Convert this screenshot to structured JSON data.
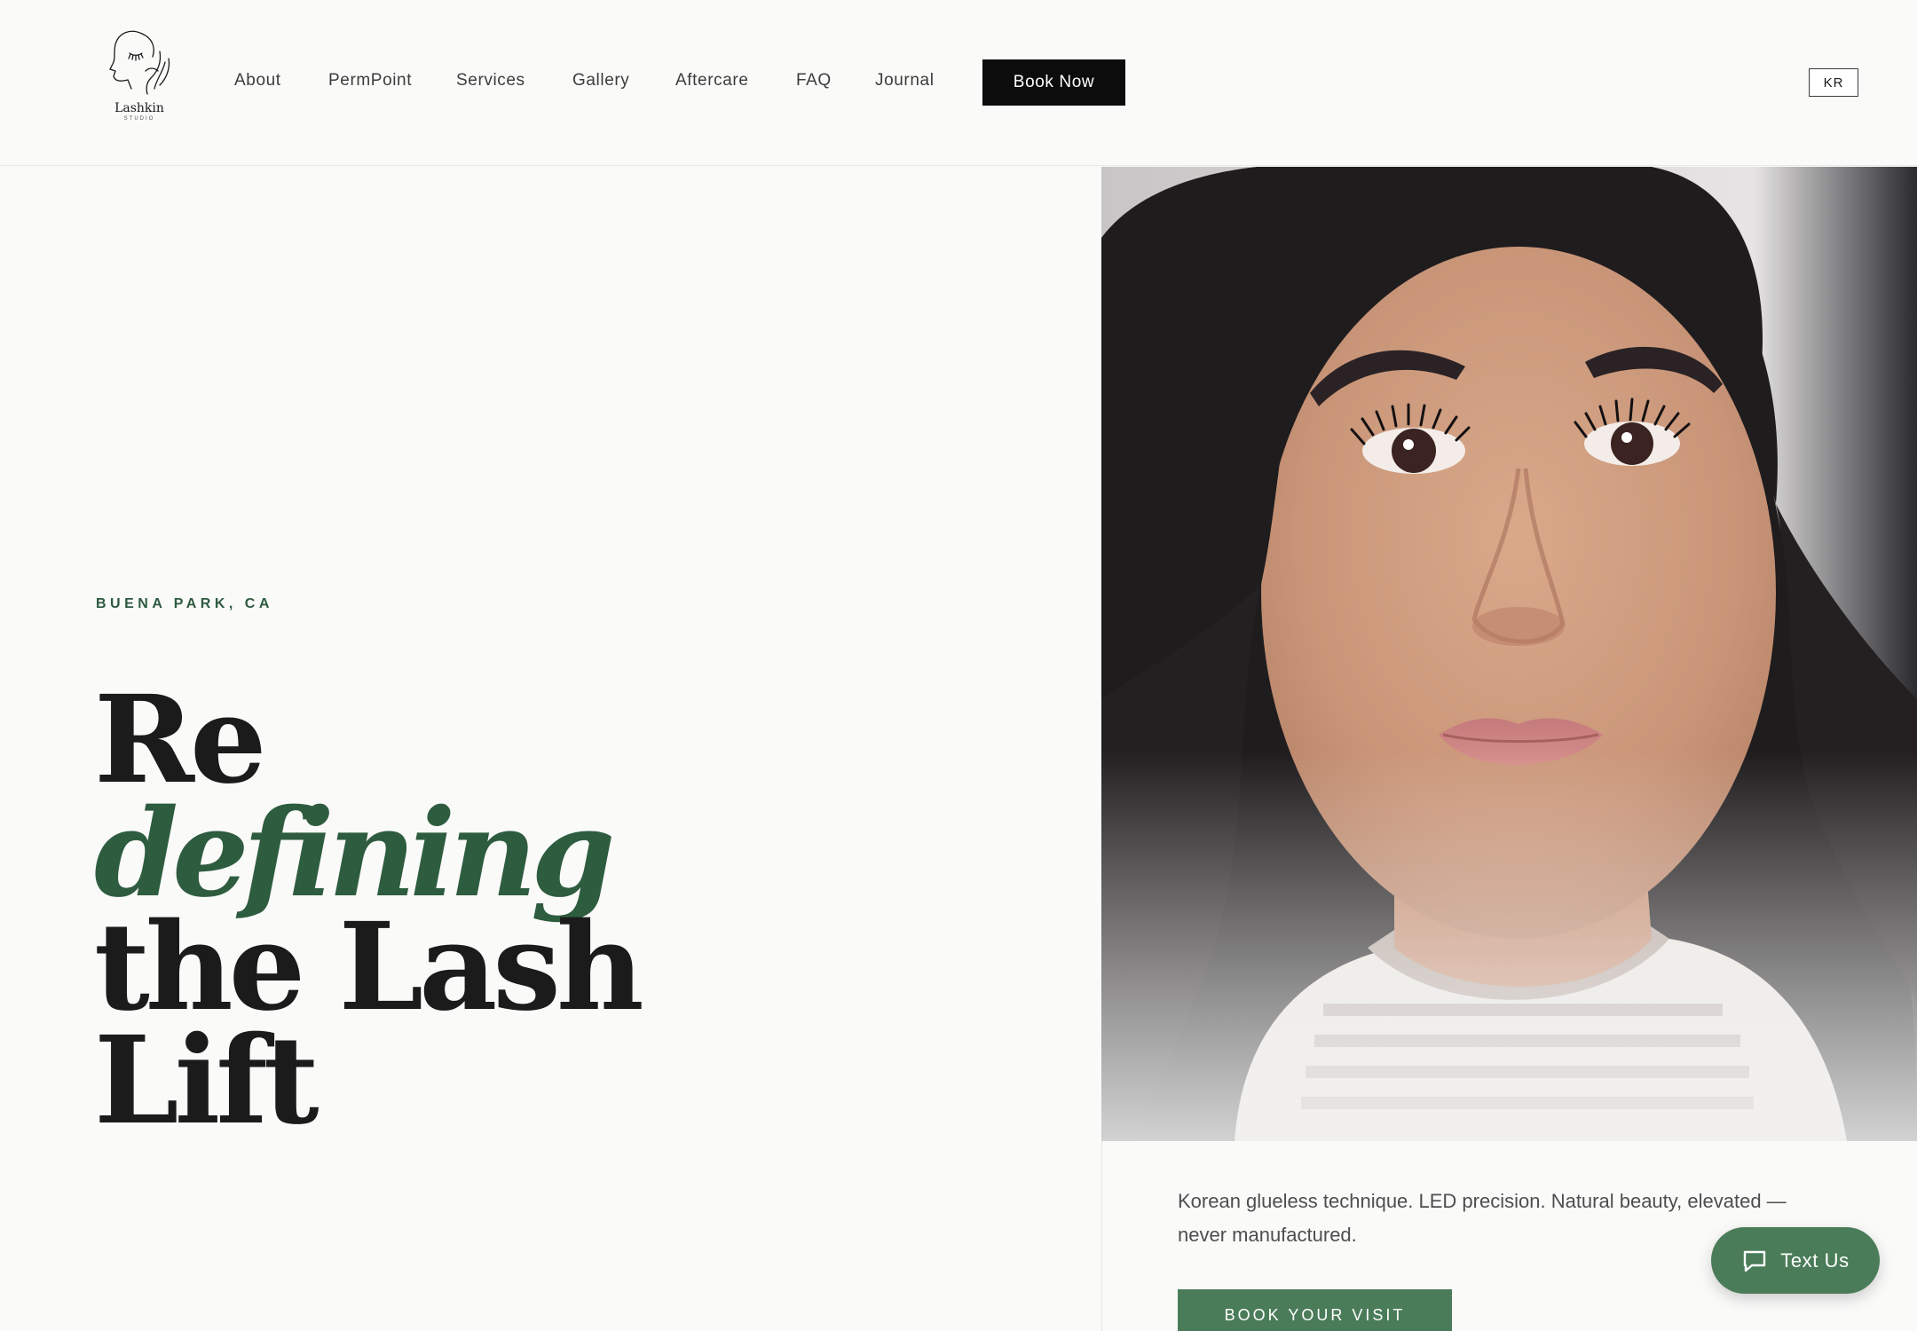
{
  "brand": {
    "name": "Lashkin",
    "sub": "STUDIO"
  },
  "nav": {
    "items": [
      {
        "label": "About"
      },
      {
        "label": "PermPoint"
      },
      {
        "label": "Services"
      },
      {
        "label": "Gallery"
      },
      {
        "label": "Aftercare"
      },
      {
        "label": "FAQ"
      },
      {
        "label": "Journal"
      }
    ],
    "cta_label": "Book Now",
    "lang_label": "KR"
  },
  "hero": {
    "location": "BUENA PARK, CA",
    "headline_line1": "Re",
    "headline_line2": "defining",
    "headline_line3": "the Lash",
    "headline_line4": "Lift",
    "tagline": "Korean glueless technique. LED precision. Natural beauty, elevated — never manufactured.",
    "cta_label": "BOOK YOUR VISIT"
  },
  "chat": {
    "label": "Text Us",
    "icon": "chat-bubble-icon"
  },
  "colors": {
    "accent_green": "#4a7c59",
    "headline_green": "#2e5c3f",
    "text_dark": "#1b1b1b",
    "background": "#fafaf9"
  }
}
